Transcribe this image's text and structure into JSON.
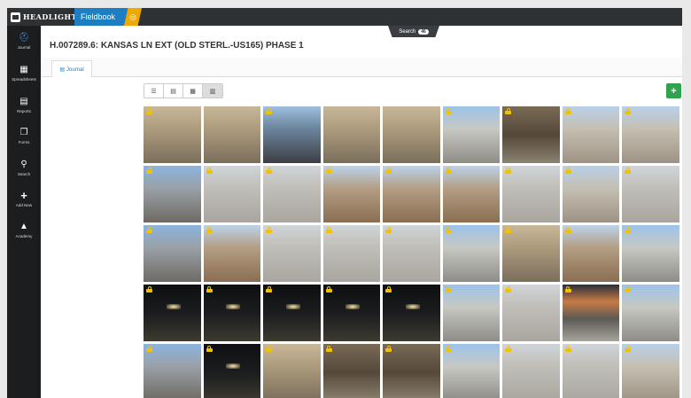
{
  "app": {
    "brand": "HEADLIGHT",
    "product": "Fieldbook"
  },
  "sidebar": {
    "items": [
      {
        "label": "Journal",
        "icon": "journal-icon",
        "active": true
      },
      {
        "label": "Spreadsheets",
        "icon": "spreadsheet-icon"
      },
      {
        "label": "Reports",
        "icon": "reports-icon"
      },
      {
        "label": "Forms",
        "icon": "forms-icon"
      },
      {
        "label": "Search",
        "icon": "search-icon"
      },
      {
        "label": "Add New",
        "icon": "plus-icon"
      },
      {
        "label": "Academy",
        "icon": "graduation-cap-icon"
      }
    ]
  },
  "header": {
    "title": "H.007289.6: KANSAS LN EXT (OLD STERL.-US165) PHASE 1",
    "search_label": "Search",
    "search_count": "46"
  },
  "tabs": {
    "journal_label": "Journal"
  },
  "toolbar": {
    "views": [
      "list-view-icon",
      "detail-view-icon",
      "medium-grid-icon",
      "large-grid-icon"
    ],
    "selected_view": "large-grid-icon",
    "add_icon": "plus-icon"
  },
  "colors": {
    "accent": "#1d7fc1",
    "product_icon": "#f0a800",
    "add_button": "#2ea44f",
    "lock": "#f2c200"
  },
  "photos": [
    {
      "scene": "workers-formwork",
      "locked": true
    },
    {
      "scene": "workers-formwork",
      "locked": false
    },
    {
      "scene": "paving-road",
      "locked": true
    },
    {
      "scene": "workers-formwork",
      "locked": false
    },
    {
      "scene": "workers-formwork",
      "locked": false
    },
    {
      "scene": "curb-road",
      "locked": true
    },
    {
      "scene": "rebar-trench",
      "locked": true
    },
    {
      "scene": "gravel-lot",
      "locked": true
    },
    {
      "scene": "gravel-lot",
      "locked": true
    },
    {
      "scene": "machinery",
      "locked": true
    },
    {
      "scene": "concrete-slab",
      "locked": true
    },
    {
      "scene": "concrete-slab",
      "locked": true
    },
    {
      "scene": "dirt-site",
      "locked": true
    },
    {
      "scene": "dirt-site",
      "locked": true
    },
    {
      "scene": "dirt-site",
      "locked": true
    },
    {
      "scene": "concrete-slab",
      "locked": true
    },
    {
      "scene": "gravel-lot",
      "locked": true
    },
    {
      "scene": "concrete-slab",
      "locked": true
    },
    {
      "scene": "machinery",
      "locked": true
    },
    {
      "scene": "dirt-site",
      "locked": true
    },
    {
      "scene": "concrete-slab",
      "locked": true
    },
    {
      "scene": "concrete-slab",
      "locked": true
    },
    {
      "scene": "concrete-slab",
      "locked": true
    },
    {
      "scene": "curb-road",
      "locked": true
    },
    {
      "scene": "workers-formwork",
      "locked": true
    },
    {
      "scene": "dirt-site",
      "locked": true
    },
    {
      "scene": "curb-road",
      "locked": true
    },
    {
      "scene": "night",
      "locked": true
    },
    {
      "scene": "night",
      "locked": true
    },
    {
      "scene": "night",
      "locked": true
    },
    {
      "scene": "night",
      "locked": true
    },
    {
      "scene": "night",
      "locked": true
    },
    {
      "scene": "curb-road",
      "locked": true
    },
    {
      "scene": "concrete-slab",
      "locked": true
    },
    {
      "scene": "sunset",
      "locked": true
    },
    {
      "scene": "curb-road",
      "locked": true
    },
    {
      "scene": "machinery",
      "locked": true
    },
    {
      "scene": "night",
      "locked": true
    },
    {
      "scene": "workers-formwork",
      "locked": true
    },
    {
      "scene": "rebar-trench",
      "locked": true
    },
    {
      "scene": "rebar-trench",
      "locked": true
    },
    {
      "scene": "curb-road",
      "locked": true
    },
    {
      "scene": "concrete-slab",
      "locked": true
    },
    {
      "scene": "concrete-slab",
      "locked": true
    },
    {
      "scene": "gravel-lot",
      "locked": true
    }
  ]
}
